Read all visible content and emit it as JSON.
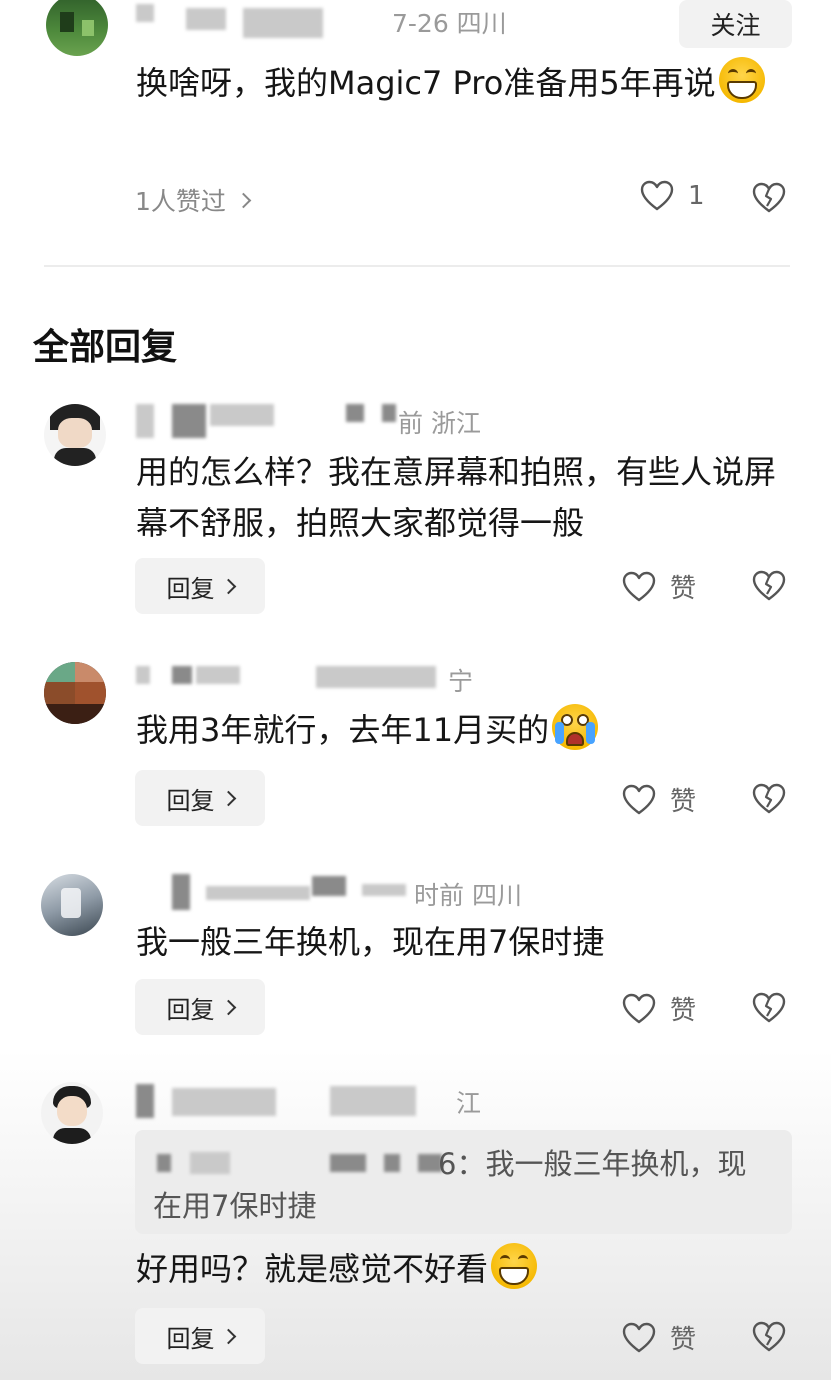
{
  "top_comment": {
    "meta": "7-26  四川",
    "follow_label": "关注",
    "text": "换啥呀，我的Magic7 Pro准备用5年再说",
    "likers": "1人赞过",
    "like_count": "1"
  },
  "section_title": "全部回复",
  "replies": [
    {
      "meta": "前  浙江",
      "text": "用的怎么样？我在意屏幕和拍照，有些人说屏幕不舒服，拍照大家都觉得一般",
      "reply_label": "回复",
      "like_label": "赞"
    },
    {
      "meta": "宁",
      "text": "我用3年就行，去年11月买的",
      "reply_label": "回复",
      "like_label": "赞"
    },
    {
      "meta": "时前  四川",
      "text": "我一般三年换机，现在用7保时捷",
      "reply_label": "回复",
      "like_label": "赞"
    },
    {
      "meta": "江",
      "quote": "6：我一般三年换机，现在用7保时捷",
      "text": "好用吗？就是感觉不好看",
      "reply_label": "回复",
      "like_label": "赞"
    }
  ],
  "icons": {
    "like": "heart-outline-icon",
    "dislike": "broken-heart-icon",
    "chevron": "chevron-right-icon",
    "emoji_grin": "grinning-emoji-icon",
    "emoji_cry": "crying-emoji-icon"
  },
  "colors": {
    "text_primary": "#161616",
    "text_meta": "#9a9a9a",
    "button_bg": "#f2f2f2"
  }
}
